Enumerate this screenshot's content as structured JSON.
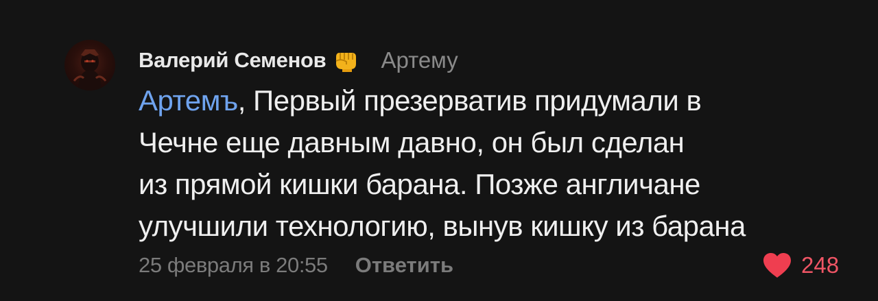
{
  "comment": {
    "author": "Валерий Семенов",
    "author_badge_icon": "fist-icon",
    "reply_to": "Артему",
    "mention": "Артемъ",
    "text_lines": [
      ", Первый презерватив придумали в",
      "Чечне еще давным давно, он был сделан",
      "из прямой кишки барана. Позже англичане",
      "улучшили технологию, вынув кишку из барана"
    ],
    "date": "25 февраля в 20:55",
    "reply_label": "Ответить",
    "likes": {
      "icon": "heart-icon",
      "count": "248",
      "color": "#ef5565"
    }
  },
  "colors": {
    "background": "#141414",
    "text": "#efefef",
    "mention": "#6fa3ee",
    "muted": "#7b7b7b"
  }
}
